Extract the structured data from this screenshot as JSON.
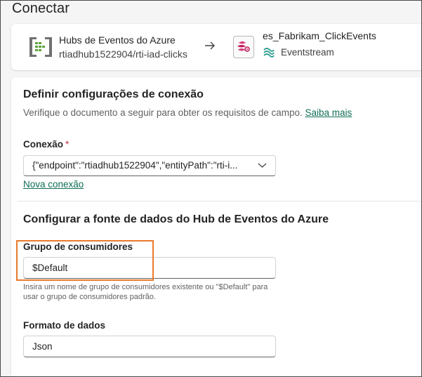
{
  "page": {
    "title": "Conectar"
  },
  "source": {
    "title": "Hubs de Eventos do Azure",
    "subtitle": "rtiadhub1522904/rti-iad-clicks",
    "icon": "event-hubs-icon"
  },
  "destination": {
    "title": "es_Fabrikam_ClickEvents",
    "type_label": "Eventstream",
    "icon": "eventstream-icon"
  },
  "connection_settings": {
    "title": "Definir configurações de conexão",
    "help_text": "Verifique o documento a seguir para obter os requisitos de campo.",
    "help_link": "Saiba mais",
    "connection_label": "Conexão",
    "required_mark": "*",
    "connection_value": "{\"endpoint\":\"rtiadhub1522904\",\"entityPath\":\"rti-i...",
    "new_connection_link": "Nova conexão"
  },
  "data_source": {
    "title": "Configurar a fonte de dados do Hub de Eventos do Azure",
    "consumer_group_label": "Grupo de consumidores",
    "consumer_group_value": "$Default",
    "consumer_group_hint": "Insira um nome de grupo de consumidores existente ou \"$Default\" para usar o grupo de consumidores padrão.",
    "data_format_label": "Formato de dados",
    "data_format_value": "Json"
  },
  "colors": {
    "accent_link": "#0f6e56",
    "highlight": "#e87a2e",
    "required": "#c4314b"
  }
}
